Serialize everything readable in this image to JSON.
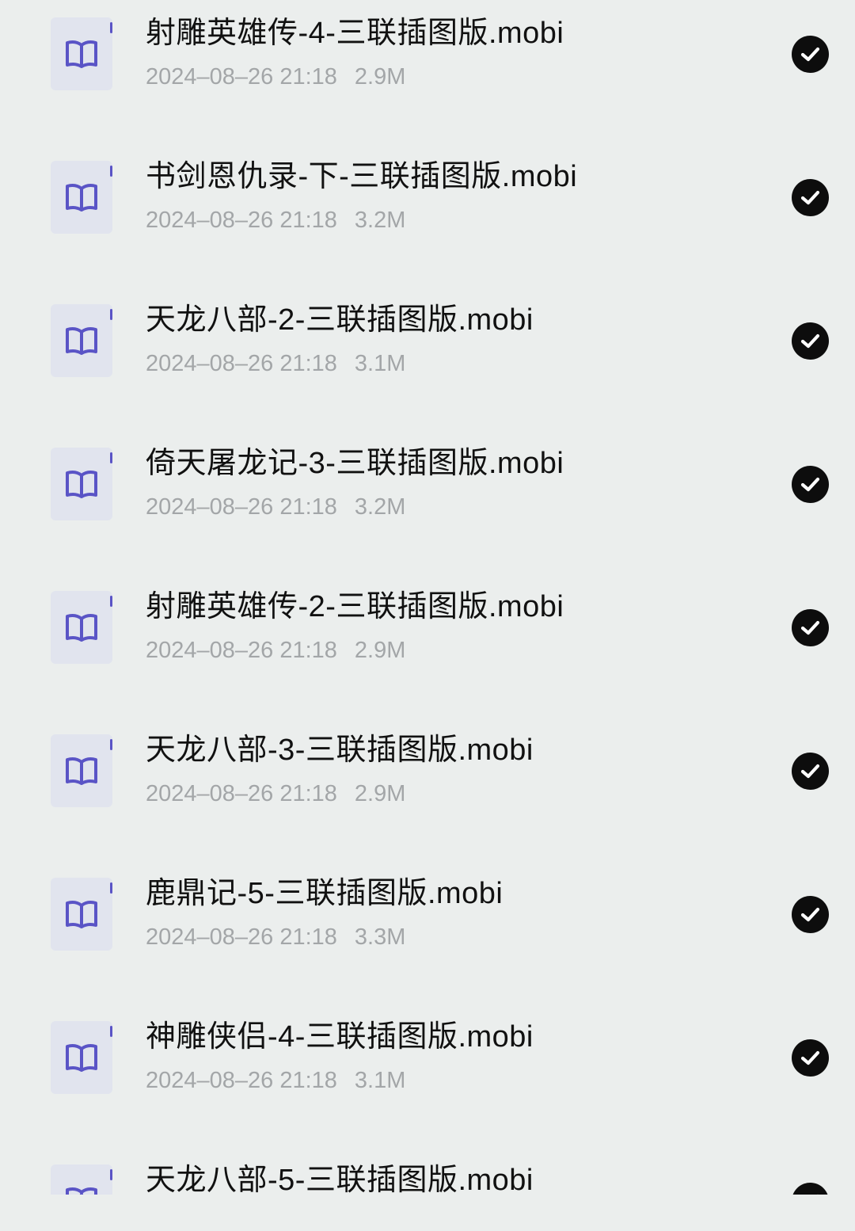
{
  "files": [
    {
      "name": "射雕英雄传-4-三联插图版.mobi",
      "date": "2024–08–26 21:18",
      "size": "2.9M",
      "icon": "book-icon",
      "selected": true
    },
    {
      "name": "书剑恩仇录-下-三联插图版.mobi",
      "date": "2024–08–26 21:18",
      "size": "3.2M",
      "icon": "book-icon",
      "selected": true
    },
    {
      "name": "天龙八部-2-三联插图版.mobi",
      "date": "2024–08–26 21:18",
      "size": "3.1M",
      "icon": "book-icon",
      "selected": true
    },
    {
      "name": "倚天屠龙记-3-三联插图版.mobi",
      "date": "2024–08–26 21:18",
      "size": "3.2M",
      "icon": "book-icon",
      "selected": true
    },
    {
      "name": "射雕英雄传-2-三联插图版.mobi",
      "date": "2024–08–26 21:18",
      "size": "2.9M",
      "icon": "book-icon",
      "selected": true
    },
    {
      "name": "天龙八部-3-三联插图版.mobi",
      "date": "2024–08–26 21:18",
      "size": "2.9M",
      "icon": "book-icon",
      "selected": true
    },
    {
      "name": "鹿鼎记-5-三联插图版.mobi",
      "date": "2024–08–26 21:18",
      "size": "3.3M",
      "icon": "book-icon",
      "selected": true
    },
    {
      "name": "神雕侠侣-4-三联插图版.mobi",
      "date": "2024–08–26 21:18",
      "size": "3.1M",
      "icon": "book-icon",
      "selected": true
    },
    {
      "name": "天龙八部-5-三联插图版.mobi",
      "icon": "book-icon",
      "selected": true
    }
  ],
  "colors": {
    "background": "#ebeeed",
    "icon_tile": "#e1e4ee",
    "icon_accent": "#5a54c6",
    "check_fill": "#0d0d0d",
    "name_text": "#111111",
    "meta_text": "#a3a6a8"
  }
}
